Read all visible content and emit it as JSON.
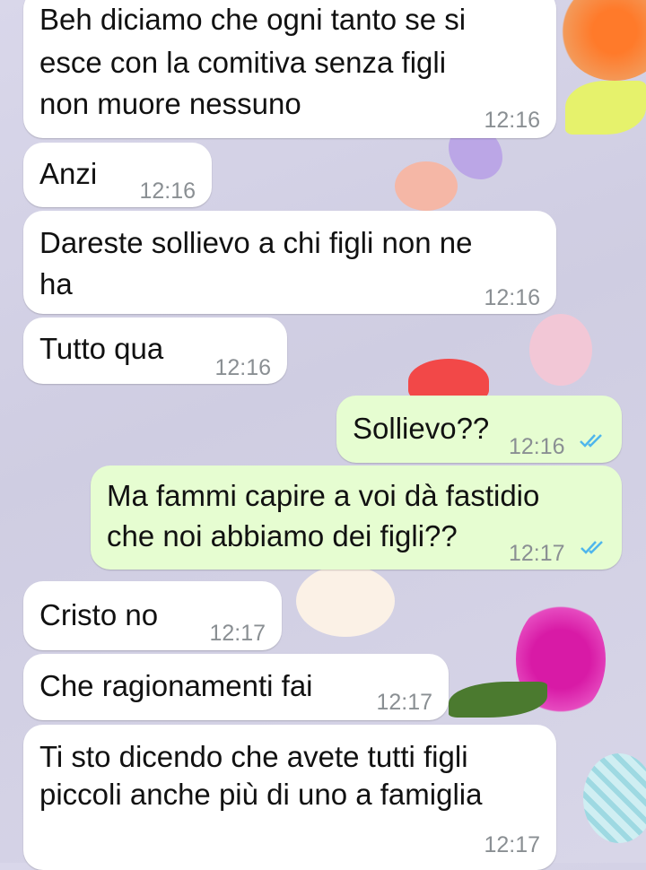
{
  "colors": {
    "incoming_bubble": "#ffffff",
    "outgoing_bubble": "#e6fdd1",
    "read_ticks": "#4fb6ec",
    "timestamp": "#8a8f93",
    "wallpaper": "#d4d2e6"
  },
  "messages": [
    {
      "direction": "in",
      "lines": [
        "Beh diciamo che ogni tanto se si",
        "esce con la comitiva senza figli",
        "non muore nessuno"
      ],
      "time": "12:16"
    },
    {
      "direction": "in",
      "lines": [
        "Anzi"
      ],
      "time": "12:16"
    },
    {
      "direction": "in",
      "lines": [
        "Dareste sollievo a chi figli non ne",
        "ha"
      ],
      "time": "12:16"
    },
    {
      "direction": "in",
      "lines": [
        "Tutto qua"
      ],
      "time": "12:16"
    },
    {
      "direction": "out",
      "lines": [
        "Sollievo??"
      ],
      "time": "12:16",
      "status": "read-double-check-icon"
    },
    {
      "direction": "out",
      "lines": [
        "Ma fammi capire a voi dà fastidio",
        "che noi abbiamo dei figli??"
      ],
      "time": "12:17",
      "status": "read-double-check-icon"
    },
    {
      "direction": "in",
      "lines": [
        "Cristo no"
      ],
      "time": "12:17"
    },
    {
      "direction": "in",
      "lines": [
        "Che ragionamenti fai"
      ],
      "time": "12:17"
    },
    {
      "direction": "in",
      "lines": [
        "Ti sto dicendo che avete tutti figli",
        "piccoli anche più di uno a famiglia"
      ],
      "time": "12:17"
    }
  ]
}
